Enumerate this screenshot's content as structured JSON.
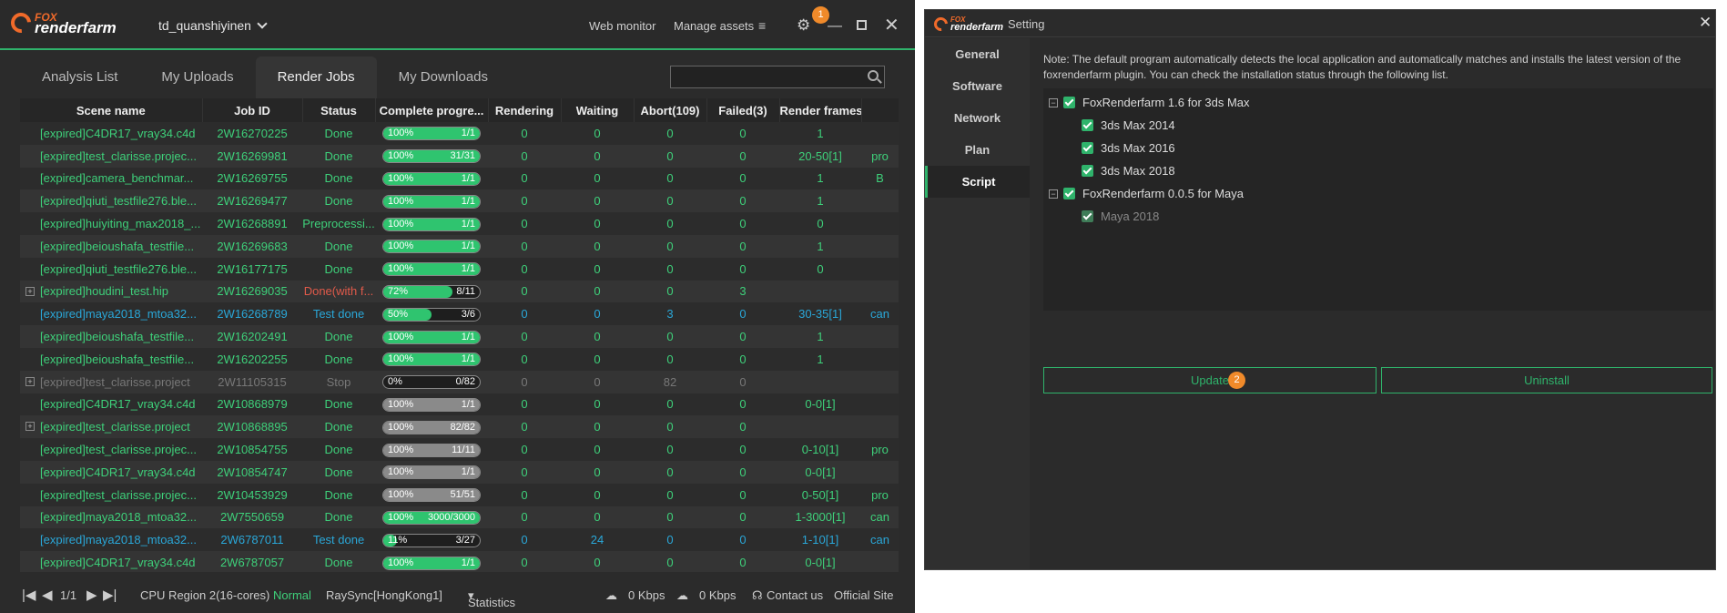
{
  "main": {
    "logo_top": "FOX",
    "logo_bottom": "renderfarm",
    "username": "td_quanshiyinen",
    "nav": {
      "web_monitor": "Web monitor",
      "manage_assets": "Manage assets"
    },
    "badge": "1",
    "tabs": [
      "Analysis List",
      "My Uploads",
      "Render Jobs",
      "My Downloads"
    ],
    "active_tab": "Render Jobs",
    "search": {
      "placeholder": "",
      "value": ""
    },
    "columns": [
      "Scene name",
      "Job ID",
      "Status",
      "Complete progre...",
      "Rendering",
      "Waiting",
      "Abort(109)",
      "Failed(3)",
      "Render frames",
      ""
    ],
    "rows": [
      {
        "name": "[expired]C4DR17_vray34.c4d",
        "id": "2W16270225",
        "status": "Done",
        "pct": "100%",
        "frac": "1/1",
        "fill": 1,
        "rendering": "0",
        "waiting": "0",
        "abort": "0",
        "failed": "0",
        "frames": "1",
        "extra": "",
        "color": "#3ed07a",
        "exp": false,
        "bar": "green"
      },
      {
        "name": "[expired]test_clarisse.projec...",
        "id": "2W16269981",
        "status": "Done",
        "pct": "100%",
        "frac": "31/31",
        "fill": 1,
        "rendering": "0",
        "waiting": "0",
        "abort": "0",
        "failed": "0",
        "frames": "20-50[1]",
        "extra": "pro",
        "color": "#3ed07a",
        "exp": false,
        "bar": "green"
      },
      {
        "name": "[expired]camera_benchmar...",
        "id": "2W16269755",
        "status": "Done",
        "pct": "100%",
        "frac": "1/1",
        "fill": 1,
        "rendering": "0",
        "waiting": "0",
        "abort": "0",
        "failed": "0",
        "frames": "1",
        "extra": "B",
        "color": "#3ed07a",
        "exp": false,
        "bar": "green"
      },
      {
        "name": "[expired]qiuti_testfile276.ble...",
        "id": "2W16269477",
        "status": "Done",
        "pct": "100%",
        "frac": "1/1",
        "fill": 1,
        "rendering": "0",
        "waiting": "0",
        "abort": "0",
        "failed": "0",
        "frames": "1",
        "extra": "",
        "color": "#3ed07a",
        "exp": false,
        "bar": "green"
      },
      {
        "name": "[expired]huiyiting_max2018_...",
        "id": "2W16268891",
        "status": "Preprocessi...",
        "pct": "100%",
        "frac": "1/1",
        "fill": 1,
        "rendering": "0",
        "waiting": "0",
        "abort": "0",
        "failed": "0",
        "frames": "0",
        "extra": "",
        "color": "#3ed07a",
        "exp": false,
        "bar": "green"
      },
      {
        "name": "[expired]beioushafa_testfile...",
        "id": "2W16269683",
        "status": "Done",
        "pct": "100%",
        "frac": "1/1",
        "fill": 1,
        "rendering": "0",
        "waiting": "0",
        "abort": "0",
        "failed": "0",
        "frames": "1",
        "extra": "",
        "color": "#3ed07a",
        "exp": false,
        "bar": "green"
      },
      {
        "name": "[expired]qiuti_testfile276.ble...",
        "id": "2W16177175",
        "status": "Done",
        "pct": "100%",
        "frac": "1/1",
        "fill": 1,
        "rendering": "0",
        "waiting": "0",
        "abort": "0",
        "failed": "0",
        "frames": "0",
        "extra": "",
        "color": "#3ed07a",
        "exp": false,
        "bar": "green"
      },
      {
        "name": "[expired]houdini_test.hip",
        "id": "2W16269035",
        "status": "Done(with f...",
        "pct": "72%",
        "frac": "8/11",
        "fill": 0.72,
        "rendering": "0",
        "waiting": "0",
        "abort": "0",
        "failed": "3",
        "frames": "",
        "extra": "",
        "color": "#3ed07a",
        "status_color": "#e05a4a",
        "exp": true,
        "bar": "green"
      },
      {
        "name": "[expired]maya2018_mtoa32...",
        "id": "2W16268789",
        "status": "Test done",
        "pct": "50%",
        "frac": "3/6",
        "fill": 0.5,
        "rendering": "0",
        "waiting": "0",
        "abort": "3",
        "failed": "0",
        "frames": "30-35[1]",
        "extra": "can",
        "color": "#2aa7d8",
        "exp": false,
        "bar": "green"
      },
      {
        "name": "[expired]beioushafa_testfile...",
        "id": "2W16202491",
        "status": "Done",
        "pct": "100%",
        "frac": "1/1",
        "fill": 1,
        "rendering": "0",
        "waiting": "0",
        "abort": "0",
        "failed": "0",
        "frames": "1",
        "extra": "",
        "color": "#3ed07a",
        "exp": false,
        "bar": "green"
      },
      {
        "name": "[expired]beioushafa_testfile...",
        "id": "2W16202255",
        "status": "Done",
        "pct": "100%",
        "frac": "1/1",
        "fill": 1,
        "rendering": "0",
        "waiting": "0",
        "abort": "0",
        "failed": "0",
        "frames": "1",
        "extra": "",
        "color": "#3ed07a",
        "exp": false,
        "bar": "green"
      },
      {
        "name": "[expired]test_clarisse.project",
        "id": "2W11105315",
        "status": "Stop",
        "pct": "0%",
        "frac": "0/82",
        "fill": 0,
        "rendering": "0",
        "waiting": "0",
        "abort": "82",
        "failed": "0",
        "frames": "",
        "extra": "",
        "color": "#777777",
        "exp": true,
        "bar": "green"
      },
      {
        "name": "[expired]C4DR17_vray34.c4d",
        "id": "2W10868979",
        "status": "Done",
        "pct": "100%",
        "frac": "1/1",
        "fill": 1,
        "rendering": "0",
        "waiting": "0",
        "abort": "0",
        "failed": "0",
        "frames": "0-0[1]",
        "extra": "",
        "color": "#3ed07a",
        "exp": false,
        "bar": "gray"
      },
      {
        "name": "[expired]test_clarisse.project",
        "id": "2W10868895",
        "status": "Done",
        "pct": "100%",
        "frac": "82/82",
        "fill": 1,
        "rendering": "0",
        "waiting": "0",
        "abort": "0",
        "failed": "0",
        "frames": "",
        "extra": "",
        "color": "#3ed07a",
        "exp": true,
        "bar": "gray"
      },
      {
        "name": "[expired]test_clarisse.projec...",
        "id": "2W10854755",
        "status": "Done",
        "pct": "100%",
        "frac": "11/11",
        "fill": 1,
        "rendering": "0",
        "waiting": "0",
        "abort": "0",
        "failed": "0",
        "frames": "0-10[1]",
        "extra": "pro",
        "color": "#3ed07a",
        "exp": false,
        "bar": "gray"
      },
      {
        "name": "[expired]C4DR17_vray34.c4d",
        "id": "2W10854747",
        "status": "Done",
        "pct": "100%",
        "frac": "1/1",
        "fill": 1,
        "rendering": "0",
        "waiting": "0",
        "abort": "0",
        "failed": "0",
        "frames": "0-0[1]",
        "extra": "",
        "color": "#3ed07a",
        "exp": false,
        "bar": "gray"
      },
      {
        "name": "[expired]test_clarisse.projec...",
        "id": "2W10453929",
        "status": "Done",
        "pct": "100%",
        "frac": "51/51",
        "fill": 1,
        "rendering": "0",
        "waiting": "0",
        "abort": "0",
        "failed": "0",
        "frames": "0-50[1]",
        "extra": "pro",
        "color": "#3ed07a",
        "exp": false,
        "bar": "gray"
      },
      {
        "name": "[expired]maya2018_mtoa32...",
        "id": "2W7550659",
        "status": "Done",
        "pct": "100%",
        "frac": "3000/3000",
        "fill": 1,
        "rendering": "0",
        "waiting": "0",
        "abort": "0",
        "failed": "0",
        "frames": "1-3000[1]",
        "extra": "can",
        "color": "#3ed07a",
        "exp": false,
        "bar": "green"
      },
      {
        "name": "[expired]maya2018_mtoa32...",
        "id": "2W6787011",
        "status": "Test done",
        "pct": "11%",
        "frac": "3/27",
        "fill": 0.11,
        "rendering": "0",
        "waiting": "24",
        "abort": "0",
        "failed": "0",
        "frames": "1-10[1]",
        "extra": "can",
        "color": "#2aa7d8",
        "exp": false,
        "bar": "green"
      },
      {
        "name": "[expired]C4DR17_vray34.c4d",
        "id": "2W6787057",
        "status": "Done",
        "pct": "100%",
        "frac": "1/1",
        "fill": 1,
        "rendering": "0",
        "waiting": "0",
        "abort": "0",
        "failed": "0",
        "frames": "0-0[1]",
        "extra": "",
        "color": "#3ed07a",
        "exp": false,
        "bar": "green"
      }
    ],
    "footer": {
      "page": "1/1",
      "region": "CPU Region 2(16-cores)",
      "region_status": "Normal",
      "raysync": "RaySync[HongKong1]",
      "statistics": "Statistics",
      "upload_speed": "0 Kbps",
      "download_speed": "0 Kbps",
      "contact": "Contact us",
      "official": "Official Site"
    }
  },
  "settings": {
    "title": "Setting",
    "logo_top": "FOX",
    "logo_bottom": "renderfarm",
    "sidebar": [
      "General",
      "Software",
      "Network",
      "Plan",
      "Script"
    ],
    "active": "Script",
    "note": "Note: The default program automatically detects the local application and automatically matches and installs the latest version of the foxrenderfarm plugin. You can check the installation status through the following list.",
    "tree": [
      {
        "label": "FoxRenderfarm 1.6 for 3ds Max",
        "children": [
          "3ds Max 2014",
          "3ds Max 2016",
          "3ds Max 2018"
        ]
      },
      {
        "label": "FoxRenderfarm 0.0.5 for Maya",
        "children": [
          "Maya 2018"
        ]
      }
    ],
    "update": "Update",
    "uninstall": "Uninstall",
    "badge": "2"
  },
  "colors": {
    "accent": "#2fb36b",
    "orange": "#f08a2a",
    "blue": "#2aa7d8",
    "red": "#e05a4a"
  }
}
